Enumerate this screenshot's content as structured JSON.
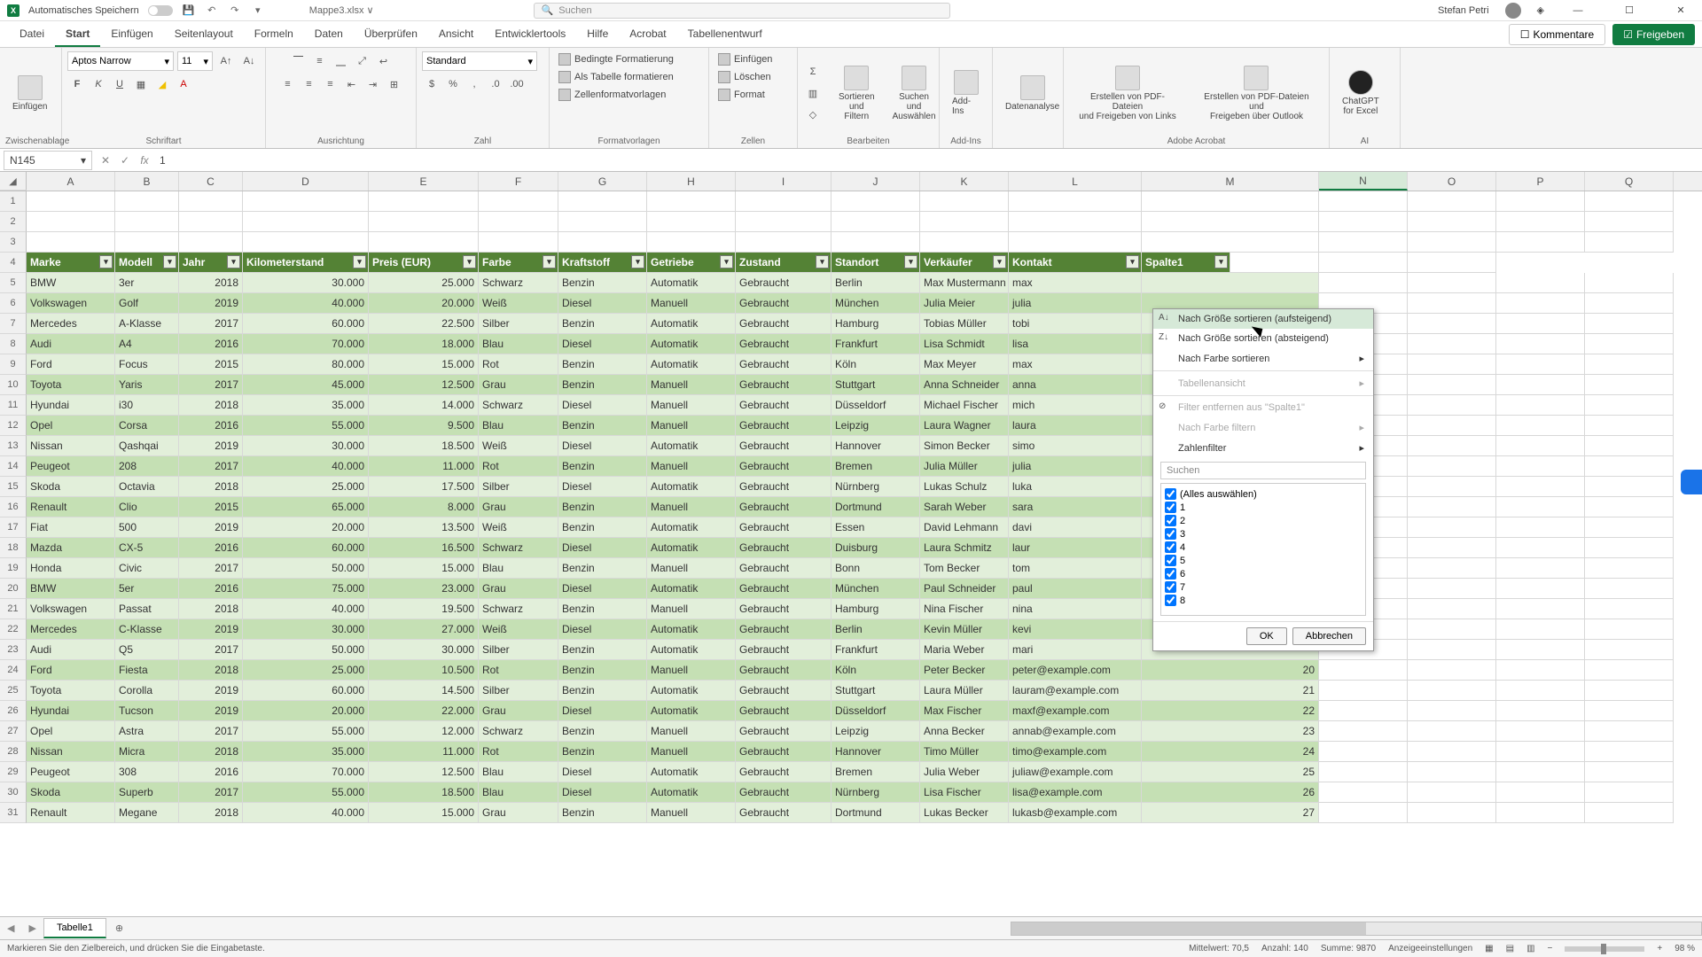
{
  "titlebar": {
    "autosave": "Automatisches Speichern",
    "filename": "Mappe3.xlsx ∨",
    "search_placeholder": "Suchen",
    "username": "Stefan Petri"
  },
  "tabs": [
    "Datei",
    "Start",
    "Einfügen",
    "Seitenlayout",
    "Formeln",
    "Daten",
    "Überprüfen",
    "Ansicht",
    "Entwicklertools",
    "Hilfe",
    "Acrobat",
    "Tabellenentwurf"
  ],
  "active_tab": 1,
  "ribbon_right": {
    "comments": "Kommentare",
    "share": "Freigeben"
  },
  "ribbon": {
    "clipboard": {
      "paste": "Einfügen",
      "label": "Zwischenablage"
    },
    "font": {
      "name": "Aptos Narrow",
      "size": "11",
      "label": "Schriftart"
    },
    "align": {
      "label": "Ausrichtung"
    },
    "number": {
      "format": "Standard",
      "label": "Zahl"
    },
    "styles": {
      "cond": "Bedingte Formatierung",
      "table": "Als Tabelle formatieren",
      "cell": "Zellenformatvorlagen",
      "label": "Formatvorlagen"
    },
    "cells": {
      "insert": "Einfügen",
      "delete": "Löschen",
      "format": "Format",
      "label": "Zellen"
    },
    "editing": {
      "sort": "Sortieren und\nFiltern",
      "find": "Suchen und\nAuswählen",
      "label": "Bearbeiten"
    },
    "addins": {
      "btn": "Add-Ins",
      "label": "Add-Ins"
    },
    "analysis": {
      "btn": "Datenanalyse"
    },
    "acrobat": {
      "a": "Erstellen von PDF-Dateien\nund Freigeben von Links",
      "b": "Erstellen von PDF-Dateien und\nFreigeben über Outlook",
      "label": "Adobe Acrobat"
    },
    "ai": {
      "btn": "ChatGPT\nfor Excel",
      "label": "AI"
    }
  },
  "namebox": "N145",
  "formula": "1",
  "columns": [
    "A",
    "B",
    "C",
    "D",
    "E",
    "F",
    "G",
    "H",
    "I",
    "J",
    "K",
    "L",
    "M",
    "N",
    "O",
    "P",
    "Q"
  ],
  "selected_col": 13,
  "headers": [
    "Marke",
    "Modell",
    "Jahr",
    "Kilometerstand",
    "Preis (EUR)",
    "Farbe",
    "Kraftstoff",
    "Getriebe",
    "Zustand",
    "Standort",
    "Verkäufer",
    "Kontakt",
    "Spalte1"
  ],
  "rows": [
    [
      "BMW",
      "3er",
      "2018",
      "30.000",
      "25.000",
      "Schwarz",
      "Benzin",
      "Automatik",
      "Gebraucht",
      "Berlin",
      "Max Mustermann",
      "max",
      ""
    ],
    [
      "Volkswagen",
      "Golf",
      "2019",
      "40.000",
      "20.000",
      "Weiß",
      "Diesel",
      "Manuell",
      "Gebraucht",
      "München",
      "Julia Meier",
      "julia",
      ""
    ],
    [
      "Mercedes",
      "A-Klasse",
      "2017",
      "60.000",
      "22.500",
      "Silber",
      "Benzin",
      "Automatik",
      "Gebraucht",
      "Hamburg",
      "Tobias Müller",
      "tobi",
      ""
    ],
    [
      "Audi",
      "A4",
      "2016",
      "70.000",
      "18.000",
      "Blau",
      "Diesel",
      "Automatik",
      "Gebraucht",
      "Frankfurt",
      "Lisa Schmidt",
      "lisa",
      ""
    ],
    [
      "Ford",
      "Focus",
      "2015",
      "80.000",
      "15.000",
      "Rot",
      "Benzin",
      "Automatik",
      "Gebraucht",
      "Köln",
      "Max Meyer",
      "max",
      ""
    ],
    [
      "Toyota",
      "Yaris",
      "2017",
      "45.000",
      "12.500",
      "Grau",
      "Benzin",
      "Manuell",
      "Gebraucht",
      "Stuttgart",
      "Anna Schneider",
      "anna",
      ""
    ],
    [
      "Hyundai",
      "i30",
      "2018",
      "35.000",
      "14.000",
      "Schwarz",
      "Diesel",
      "Manuell",
      "Gebraucht",
      "Düsseldorf",
      "Michael Fischer",
      "mich",
      ""
    ],
    [
      "Opel",
      "Corsa",
      "2016",
      "55.000",
      "9.500",
      "Blau",
      "Benzin",
      "Manuell",
      "Gebraucht",
      "Leipzig",
      "Laura Wagner",
      "laura",
      ""
    ],
    [
      "Nissan",
      "Qashqai",
      "2019",
      "30.000",
      "18.500",
      "Weiß",
      "Diesel",
      "Automatik",
      "Gebraucht",
      "Hannover",
      "Simon Becker",
      "simo",
      ""
    ],
    [
      "Peugeot",
      "208",
      "2017",
      "40.000",
      "11.000",
      "Rot",
      "Benzin",
      "Manuell",
      "Gebraucht",
      "Bremen",
      "Julia Müller",
      "julia",
      ""
    ],
    [
      "Skoda",
      "Octavia",
      "2018",
      "25.000",
      "17.500",
      "Silber",
      "Diesel",
      "Automatik",
      "Gebraucht",
      "Nürnberg",
      "Lukas Schulz",
      "luka",
      ""
    ],
    [
      "Renault",
      "Clio",
      "2015",
      "65.000",
      "8.000",
      "Grau",
      "Benzin",
      "Manuell",
      "Gebraucht",
      "Dortmund",
      "Sarah Weber",
      "sara",
      ""
    ],
    [
      "Fiat",
      "500",
      "2019",
      "20.000",
      "13.500",
      "Weiß",
      "Benzin",
      "Automatik",
      "Gebraucht",
      "Essen",
      "David Lehmann",
      "davi",
      ""
    ],
    [
      "Mazda",
      "CX-5",
      "2016",
      "60.000",
      "16.500",
      "Schwarz",
      "Diesel",
      "Automatik",
      "Gebraucht",
      "Duisburg",
      "Laura Schmitz",
      "laur",
      ""
    ],
    [
      "Honda",
      "Civic",
      "2017",
      "50.000",
      "15.000",
      "Blau",
      "Benzin",
      "Manuell",
      "Gebraucht",
      "Bonn",
      "Tom Becker",
      "tom",
      ""
    ],
    [
      "BMW",
      "5er",
      "2016",
      "75.000",
      "23.000",
      "Grau",
      "Diesel",
      "Automatik",
      "Gebraucht",
      "München",
      "Paul Schneider",
      "paul",
      ""
    ],
    [
      "Volkswagen",
      "Passat",
      "2018",
      "40.000",
      "19.500",
      "Schwarz",
      "Benzin",
      "Manuell",
      "Gebraucht",
      "Hamburg",
      "Nina Fischer",
      "nina",
      ""
    ],
    [
      "Mercedes",
      "C-Klasse",
      "2019",
      "30.000",
      "27.000",
      "Weiß",
      "Diesel",
      "Automatik",
      "Gebraucht",
      "Berlin",
      "Kevin Müller",
      "kevi",
      ""
    ],
    [
      "Audi",
      "Q5",
      "2017",
      "50.000",
      "30.000",
      "Silber",
      "Benzin",
      "Automatik",
      "Gebraucht",
      "Frankfurt",
      "Maria Weber",
      "mari",
      ""
    ],
    [
      "Ford",
      "Fiesta",
      "2018",
      "25.000",
      "10.500",
      "Rot",
      "Benzin",
      "Manuell",
      "Gebraucht",
      "Köln",
      "Peter Becker",
      "peter@example.com",
      "20"
    ],
    [
      "Toyota",
      "Corolla",
      "2019",
      "60.000",
      "14.500",
      "Silber",
      "Benzin",
      "Automatik",
      "Gebraucht",
      "Stuttgart",
      "Laura Müller",
      "lauram@example.com",
      "21"
    ],
    [
      "Hyundai",
      "Tucson",
      "2019",
      "20.000",
      "22.000",
      "Grau",
      "Diesel",
      "Automatik",
      "Gebraucht",
      "Düsseldorf",
      "Max Fischer",
      "maxf@example.com",
      "22"
    ],
    [
      "Opel",
      "Astra",
      "2017",
      "55.000",
      "12.000",
      "Schwarz",
      "Benzin",
      "Manuell",
      "Gebraucht",
      "Leipzig",
      "Anna Becker",
      "annab@example.com",
      "23"
    ],
    [
      "Nissan",
      "Micra",
      "2018",
      "35.000",
      "11.000",
      "Rot",
      "Benzin",
      "Manuell",
      "Gebraucht",
      "Hannover",
      "Timo Müller",
      "timo@example.com",
      "24"
    ],
    [
      "Peugeot",
      "308",
      "2016",
      "70.000",
      "12.500",
      "Blau",
      "Diesel",
      "Automatik",
      "Gebraucht",
      "Bremen",
      "Julia Weber",
      "juliaw@example.com",
      "25"
    ],
    [
      "Skoda",
      "Superb",
      "2017",
      "55.000",
      "18.500",
      "Blau",
      "Diesel",
      "Automatik",
      "Gebraucht",
      "Nürnberg",
      "Lisa Fischer",
      "lisa@example.com",
      "26"
    ],
    [
      "Renault",
      "Megane",
      "2018",
      "40.000",
      "15.000",
      "Grau",
      "Benzin",
      "Manuell",
      "Gebraucht",
      "Dortmund",
      "Lukas Becker",
      "lukasb@example.com",
      "27"
    ]
  ],
  "filter": {
    "sort_asc": "Nach Größe sortieren (aufsteigend)",
    "sort_desc": "Nach Größe sortieren (absteigend)",
    "sort_color": "Nach Farbe sortieren",
    "table_view": "Tabellenansicht",
    "clear": "Filter entfernen aus \"Spalte1\"",
    "filter_color": "Nach Farbe filtern",
    "num_filter": "Zahlenfilter",
    "search": "Suchen",
    "select_all": "(Alles auswählen)",
    "values": [
      "1",
      "2",
      "3",
      "4",
      "5",
      "6",
      "7",
      "8"
    ],
    "ok": "OK",
    "cancel": "Abbrechen"
  },
  "sheet": {
    "tab": "Tabelle1"
  },
  "status": {
    "msg": "Markieren Sie den Zielbereich, und drücken Sie die Eingabetaste.",
    "avg": "Mittelwert: 70,5",
    "count": "Anzahl: 140",
    "sum": "Summe: 9870",
    "display": "Anzeigeeinstellungen",
    "zoom": "98 %"
  }
}
